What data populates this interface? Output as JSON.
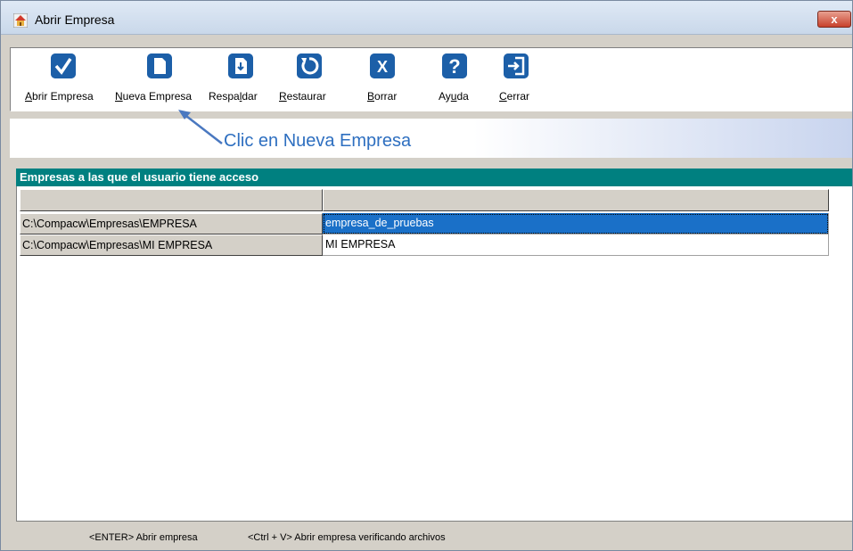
{
  "window": {
    "title": "Abrir Empresa",
    "close_label": "x"
  },
  "toolbar": {
    "buttons": [
      {
        "label_u": "A",
        "label_rest": "brir Empresa",
        "icon": "checkmark-icon"
      },
      {
        "label_u": "N",
        "label_rest": "ueva Empresa",
        "icon": "new-document-icon"
      },
      {
        "label_pre": "Respa",
        "label_u": "l",
        "label_rest": "dar",
        "icon": "backup-icon"
      },
      {
        "label_u": "R",
        "label_rest": "estaurar",
        "icon": "restore-icon"
      },
      {
        "label_u": "B",
        "label_rest": "orrar",
        "icon": "delete-icon"
      },
      {
        "label_pre": "Ay",
        "label_u": "u",
        "label_rest": "da",
        "icon": "help-icon"
      },
      {
        "label_u": "C",
        "label_rest": "errar",
        "icon": "exit-icon"
      }
    ]
  },
  "banner": {
    "text": "Clic en Nueva Empresa"
  },
  "group": {
    "title": "Empresas a las que el usuario tiene acceso"
  },
  "rows": [
    {
      "path": "C:\\Compacw\\Empresas\\EMPRESA",
      "name": "empresa_de_pruebas",
      "selected": true
    },
    {
      "path": "C:\\Compacw\\Empresas\\MI EMPRESA",
      "name": "MI EMPRESA",
      "selected": false
    }
  ],
  "status": {
    "hint1": "<ENTER> Abrir empresa",
    "hint2": "<Ctrl + V> Abrir empresa verificando archivos"
  },
  "colors": {
    "accent": "#1c5fa8",
    "header": "#008080",
    "selection": "#1a70c8",
    "banner_text": "#2e6fc0"
  }
}
